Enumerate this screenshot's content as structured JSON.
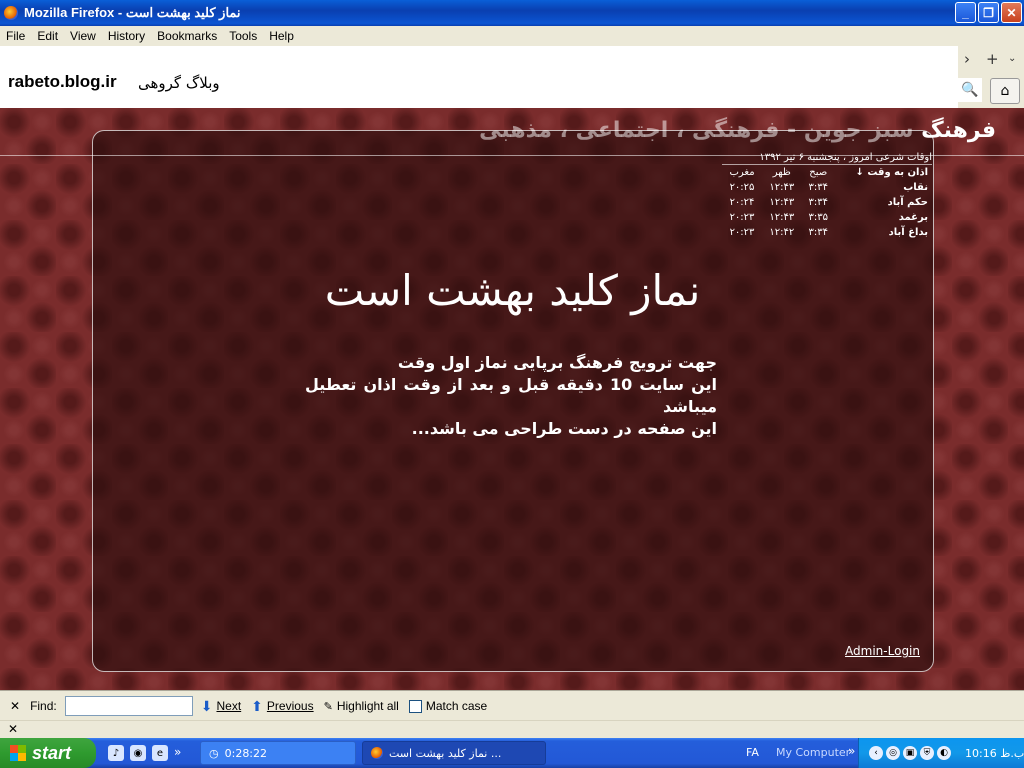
{
  "window": {
    "title": "نماز کلید بهشت است - Mozilla Firefox",
    "minimize": "_",
    "restore": "❐",
    "close": "✕"
  },
  "menu": [
    "File",
    "Edit",
    "View",
    "History",
    "Bookmarks",
    "Tools",
    "Help"
  ],
  "toolbar": {
    "site_name": "rabeto.blog.ir",
    "site_sub": "وبلاگ گروهی",
    "forward_icon": "›",
    "new_tab_icon": "+",
    "tab_list_icon": "⌄",
    "search_icon": "🔍",
    "home_icon": "⌂"
  },
  "page": {
    "header_title_bold": "فرهنگ",
    "header_title_rest": " سبز جوین - فرهنگی ، اجتماعی ، مذهبی",
    "prayer_times": {
      "date": "اوقات شرعی امروز ، پنجشنبه ۶ تیر ۱۳۹۲",
      "headers": [
        "اذان به وقت ↓",
        "صبح",
        "ظهر",
        "مغرب"
      ],
      "rows": [
        {
          "city": "نقاب",
          "sobh": "۳:۳۴",
          "zohr": "۱۲:۴۳",
          "maghreb": "۲۰:۲۵"
        },
        {
          "city": "حکم آباد",
          "sobh": "۳:۳۴",
          "zohr": "۱۲:۴۳",
          "maghreb": "۲۰:۲۴"
        },
        {
          "city": "برغمد",
          "sobh": "۳:۳۵",
          "zohr": "۱۲:۴۳",
          "maghreb": "۲۰:۲۳"
        },
        {
          "city": "بداغ آباد",
          "sobh": "۳:۳۴",
          "zohr": "۱۲:۴۲",
          "maghreb": "۲۰:۲۳"
        }
      ]
    },
    "main_title": "نماز کلید بهشت است",
    "lines": [
      "جهت ترویج فرهنگ برپایی نماز اول وقت",
      "این سایت 10 دقیقه قبل و بعد از وقت اذان تعطیل میباشد",
      "این صفحه در دست طراحی می باشد..."
    ],
    "admin_login": "Admin-Login"
  },
  "findbar": {
    "close": "✕",
    "label": "Find:",
    "input_value": "",
    "next": "Next",
    "previous": "Previous",
    "highlight_all": "Highlight all",
    "match_case": "Match case"
  },
  "bar2": {
    "close": "✕"
  },
  "taskbar": {
    "start": "start",
    "chevron": "»",
    "task1": "0:28:22",
    "task2": "نماز کلید بهشت است ...",
    "lang": "FA",
    "my_computer": "My Computer",
    "clock": "10:16 ب.ظ"
  }
}
